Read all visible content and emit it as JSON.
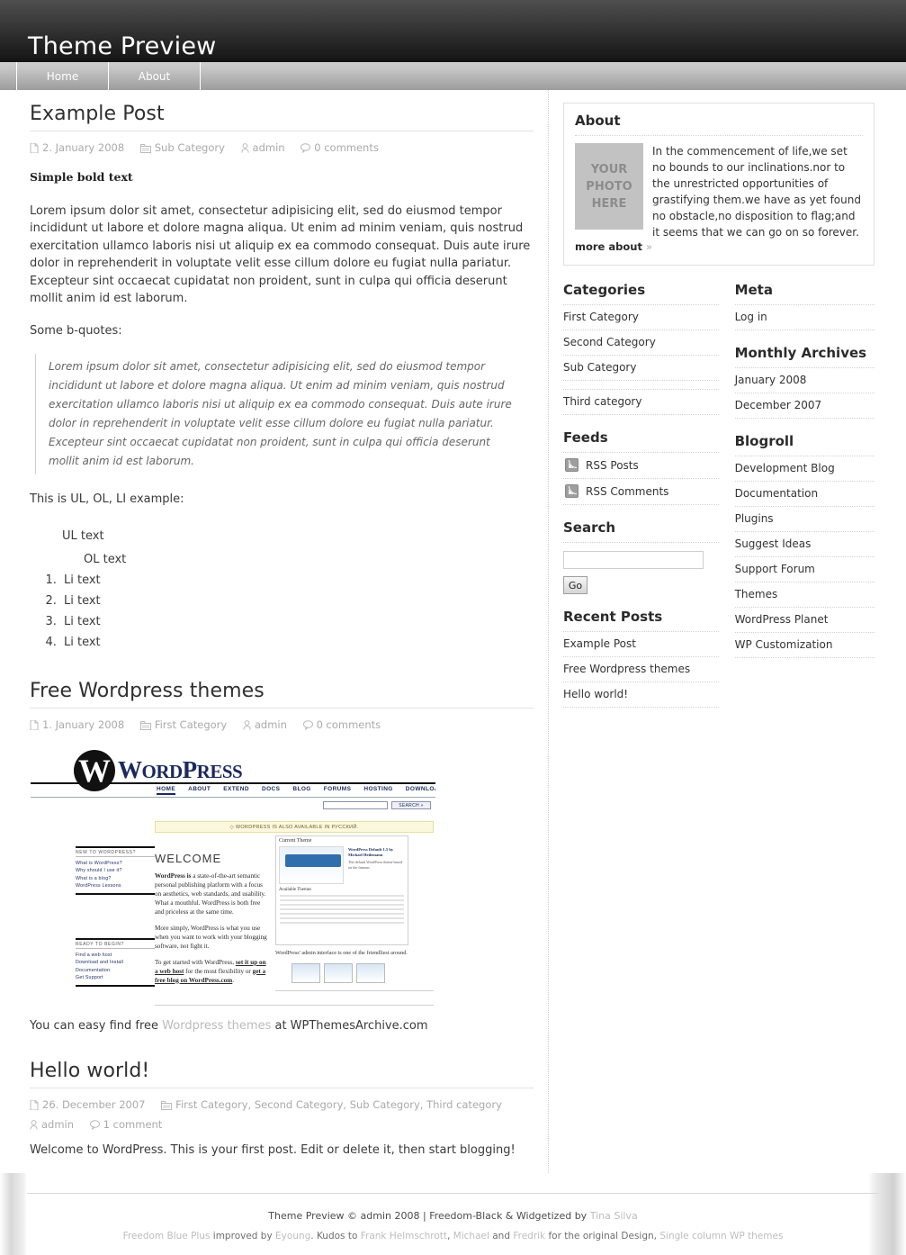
{
  "header": {
    "title": "Theme Preview"
  },
  "nav": {
    "items": [
      {
        "label": "Home"
      },
      {
        "label": "About"
      }
    ]
  },
  "posts": [
    {
      "title": "Example Post",
      "meta": {
        "date": "2. January 2008",
        "categories": "Sub Category",
        "author": "admin",
        "comments": "0 comments"
      },
      "lead": "Simple bold text",
      "paragraph1": "Lorem ipsum dolor sit amet, consectetur adipisicing elit, sed do eiusmod tempor incididunt ut labore et dolore magna aliqua. Ut enim ad minim veniam, quis nostrud exercitation ullamco laboris nisi ut aliquip ex ea commodo consequat. Duis aute irure dolor in reprehenderit in voluptate velit esse cillum dolore eu fugiat nulla pariatur. Excepteur sint occaecat cupidatat non proident, sunt in culpa qui officia deserunt mollit anim id est laborum.",
      "quote_intro": "Some b-quotes:",
      "blockquote": "Lorem ipsum dolor sit amet, consectetur adipisicing elit, sed do eiusmod tempor incididunt ut labore et dolore magna aliqua. Ut enim ad minim veniam, quis nostrud exercitation ullamco laboris nisi ut aliquip ex ea commodo consequat. Duis aute irure dolor in reprehenderit in voluptate velit esse cillum dolore eu fugiat nulla pariatur. Excepteur sint occaecat cupidatat non proident, sunt in culpa qui officia deserunt mollit anim id est laborum.",
      "list_intro": "This is UL, OL, LI example:",
      "ul_text": "UL text",
      "ol_text": "OL text",
      "li_items": [
        "Li text",
        "Li text",
        "Li text",
        "Li text"
      ]
    },
    {
      "title": "Free Wordpress themes",
      "meta": {
        "date": "1. January 2008",
        "categories": "First Category",
        "author": "admin",
        "comments": "0 comments"
      },
      "note_before": "You can easy find free ",
      "note_link": "Wordpress themes",
      "note_after": " at WPThemesArchive.com"
    },
    {
      "title": "Hello world!",
      "meta": {
        "date": "26. December 2007",
        "categories": "First Category, Second Category, Sub Category, Third category",
        "author": "admin",
        "comments": "1 comment"
      },
      "paragraph1": "Welcome to WordPress. This is your first post. Edit or delete it, then start blogging!"
    }
  ],
  "wp_screenshot": {
    "wordmark_a": "W",
    "wordmark_b": "ORD",
    "wordmark_c": "P",
    "wordmark_d": "RESS",
    "logo_letter": "W",
    "nav": [
      "HOME",
      "ABOUT",
      "EXTEND",
      "DOCS",
      "BLOG",
      "FORUMS",
      "HOSTING",
      "DOWNLOAD"
    ],
    "search_button": "SEARCH »",
    "notice": "◇ WORDPRESS IS ALSO AVAILABLE IN РУССКИЙ.",
    "welcome": "WELCOME",
    "copy1_bold": "WordPress is",
    "copy1": " a state-of-the-art semantic personal publishing platform with a focus on aesthetics, web standards, and usability. What a mouthful. WordPress is both free and priceless at the same time.",
    "copy2": "More simply, WordPress is what you use when you want to work with your blogging software, not fight it.",
    "copy3_pre": "To get started with WordPress, ",
    "copy3_link1": "set it up on a web host",
    "copy3_mid": " for the most flexibility or ",
    "copy3_link2": "get a free blog on WordPress.com",
    "copy3_end": ".",
    "side1_heading": "NEW TO WORDPRESS?",
    "side1_links": [
      "What is WordPress?",
      "Why should I use it?",
      "What is a blog?",
      "WordPress Lessons"
    ],
    "side2_heading": "READY TO BEGIN?",
    "side2_links": [
      "Find a web host",
      "Download and Install",
      "Documentation",
      "Get Support"
    ],
    "panel_title": "Current Theme",
    "panel_sub": "WordPress Default 1.5 by Michael Heilemann",
    "panel_sub2": "The default WordPress theme based on the famous",
    "panel_list_title": "Available Themes",
    "caption": "WordPress' admin interface is one of the friendliest around."
  },
  "sidebar": {
    "about": {
      "heading": "About",
      "photo_lines": [
        "YOUR",
        "PHOTO",
        "HERE"
      ],
      "text": "In the commencement of life,we set no bounds to our inclinations.nor to the unrestricted opportunities of grastifying them.we have as yet found no obstacle,no disposition to flag;and it seems that we can go on so forever.",
      "more_label": "more about",
      "more_chevron": "»"
    },
    "left_widgets": [
      {
        "heading": "Categories",
        "items": [
          {
            "label": "First Category"
          },
          {
            "label": "Second Category"
          },
          {
            "label": "Sub Category"
          },
          {
            "label": "",
            "spacer": true
          },
          {
            "label": "Third category"
          }
        ]
      },
      {
        "heading": "Feeds",
        "feeds": [
          {
            "label": "RSS Posts",
            "icon": "rss-icon"
          },
          {
            "label": "RSS Comments",
            "icon": "rss-icon"
          }
        ]
      },
      {
        "heading": "Search",
        "search_value": "",
        "search_placeholder": "",
        "go_label": "Go"
      },
      {
        "heading": "Recent Posts",
        "items": [
          {
            "label": "Example Post"
          },
          {
            "label": "Free Wordpress themes"
          },
          {
            "label": "Hello world!"
          }
        ]
      }
    ],
    "right_widgets": [
      {
        "heading": "Meta",
        "items": [
          {
            "label": "Log in"
          }
        ]
      },
      {
        "heading": "Monthly Archives",
        "items": [
          {
            "label": "January 2008"
          },
          {
            "label": "December 2007"
          }
        ]
      },
      {
        "heading": "Blogroll",
        "items": [
          {
            "label": "Development Blog"
          },
          {
            "label": "Documentation"
          },
          {
            "label": "Plugins"
          },
          {
            "label": "Suggest Ideas"
          },
          {
            "label": "Support Forum"
          },
          {
            "label": "Themes"
          },
          {
            "label": "WordPress Planet"
          },
          {
            "label": "WP Customization"
          }
        ]
      }
    ]
  },
  "footer": {
    "line1_a": "Theme Preview © admin 2008 | Freedom-Black & Widgetized by ",
    "line1_link": "Tina Silva",
    "line2_p1": "Freedom Blue Plus",
    "line2_p2": " improved by ",
    "line2_p3": "Eyoung",
    "line2_p4": ". Kudos to ",
    "line2_p5": "Frank Helmschrott",
    "line2_p6": ", ",
    "line2_p7": "Michael",
    "line2_p8": " and ",
    "line2_p9": "Fredrik",
    "line2_p10": " for the original Design",
    "line2_p11": ", ",
    "line2_p12": "Single column WP themes"
  }
}
